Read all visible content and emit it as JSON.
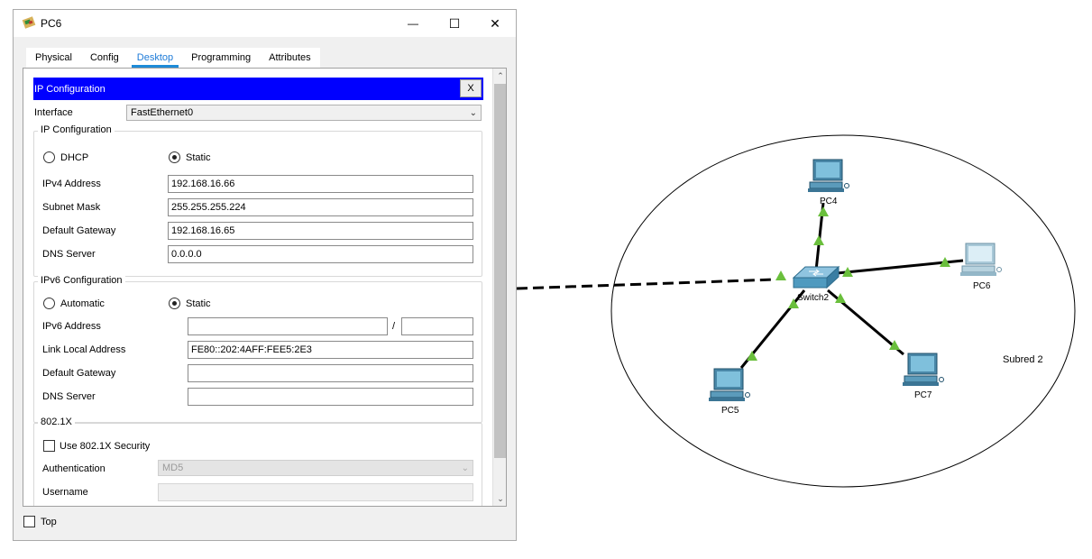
{
  "window": {
    "title": "PC6",
    "minimize_symbol": "—",
    "maximize_symbol": "☐",
    "close_symbol": "✕"
  },
  "tabs": [
    {
      "label": "Physical",
      "active": false
    },
    {
      "label": "Config",
      "active": false
    },
    {
      "label": "Desktop",
      "active": true
    },
    {
      "label": "Programming",
      "active": false
    },
    {
      "label": "Attributes",
      "active": false
    }
  ],
  "ip_config": {
    "header": "IP Configuration",
    "close_label": "X",
    "interface_label": "Interface",
    "interface_value": "FastEthernet0",
    "ipv4": {
      "legend": "IP Configuration",
      "dhcp_label": "DHCP",
      "static_label": "Static",
      "mode": "static",
      "ipv4_address_label": "IPv4 Address",
      "ipv4_address": "192.168.16.66",
      "subnet_mask_label": "Subnet Mask",
      "subnet_mask": "255.255.255.224",
      "default_gateway_label": "Default Gateway",
      "default_gateway": "192.168.16.65",
      "dns_server_label": "DNS Server",
      "dns_server": "0.0.0.0"
    },
    "ipv6": {
      "legend": "IPv6 Configuration",
      "automatic_label": "Automatic",
      "static_label": "Static",
      "mode": "static",
      "ipv6_address_label": "IPv6 Address",
      "ipv6_address": "",
      "prefix_separator": "/",
      "prefix": "",
      "link_local_label": "Link Local Address",
      "link_local": "FE80::202:4AFF:FEE5:2E3",
      "default_gateway_label": "Default Gateway",
      "default_gateway": "",
      "dns_server_label": "DNS Server",
      "dns_server": ""
    },
    "dot1x": {
      "legend": "802.1X",
      "use_security_label": "Use 802.1X Security",
      "use_security": false,
      "authentication_label": "Authentication",
      "authentication_value": "MD5",
      "username_label": "Username",
      "username": ""
    }
  },
  "footer": {
    "top_label": "Top",
    "top_checked": false
  },
  "network": {
    "switch_label": "Switch2",
    "pc4_label": "PC4",
    "pc5_label": "PC5",
    "pc6_label": "PC6",
    "pc7_label": "PC7",
    "area_label": "Subred 2",
    "link_up_color": "#6abf3c",
    "pc_color": "#4a88a8",
    "switch_color": "#4f9abf"
  },
  "colors": {
    "header_blue": "#0000ff",
    "tab_accent": "#1e8bd8"
  }
}
